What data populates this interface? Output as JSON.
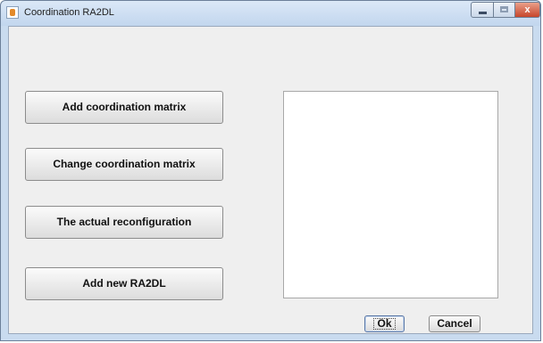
{
  "window": {
    "title": "Coordination RA2DL",
    "controls": {
      "minimize_icon": "minimize-icon",
      "maximize_icon": "maximize-icon",
      "close_label": "x"
    }
  },
  "buttons": {
    "add_matrix": "Add coordination matrix",
    "change_matrix": "Change coordination matrix",
    "reconfiguration": "The actual reconfiguration",
    "add_ra2dl": "Add new RA2DL"
  },
  "footer": {
    "ok": "Ok",
    "cancel": "Cancel"
  }
}
